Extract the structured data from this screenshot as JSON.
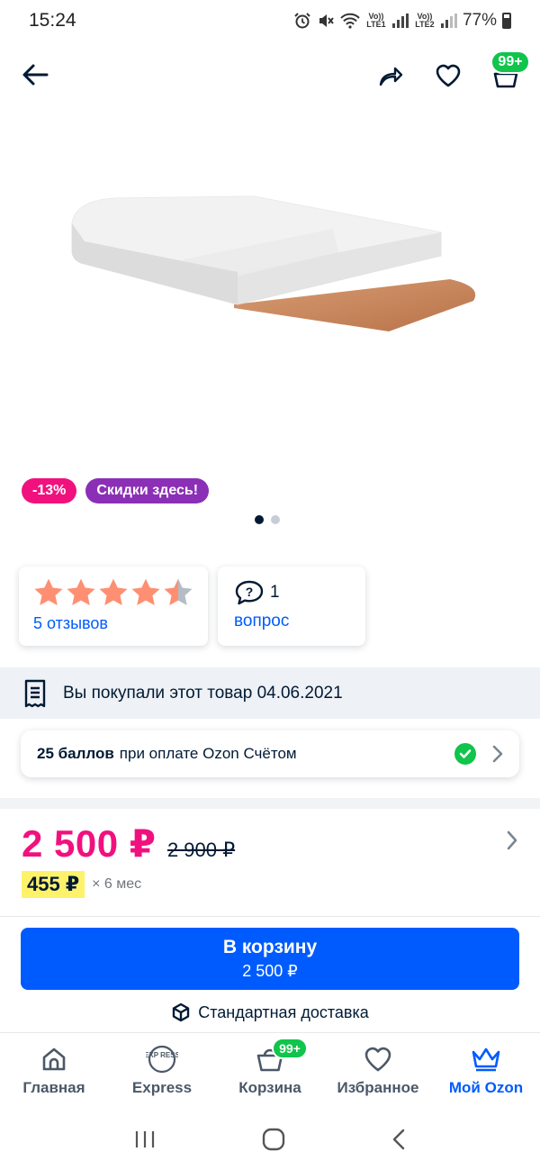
{
  "status_bar": {
    "time": "15:24",
    "sim1": "Vo)) LTE1",
    "sim2": "Vo)) LTE2",
    "battery": "77%"
  },
  "top_nav": {
    "cart_badge": "99+"
  },
  "product": {
    "badges": {
      "discount": "-13%",
      "sale": "Скидки здесь!"
    },
    "images_count": 2,
    "active_image": 1
  },
  "rating": {
    "stars": 4.5,
    "reviews_label": "5 отзывов"
  },
  "questions": {
    "count": "1",
    "label": "вопрос"
  },
  "purchased": {
    "text": "Вы покупали этот товар 04.06.2021"
  },
  "points": {
    "amount": "25 баллов",
    "text": "при оплате Ozon Счётом"
  },
  "price": {
    "current": "2 500 ₽",
    "old": "2 900 ₽",
    "installment_price": "455 ₽",
    "installment_term": "× 6 мес"
  },
  "cart_button": {
    "label": "В корзину",
    "price": "2 500 ₽"
  },
  "delivery": {
    "text": "Стандартная доставка"
  },
  "tabbar": {
    "home": "Главная",
    "express": "Express",
    "express_icon_text": "EXP RESS",
    "cart": "Корзина",
    "cart_badge": "99+",
    "favorites": "Избранное",
    "my_ozon": "Мой Ozon"
  },
  "colors": {
    "brand_blue": "#005bff",
    "price_pink": "#f1117e",
    "sale_purple": "#8b2fb6",
    "badge_green": "#10c44c",
    "installment_yellow": "#fff26b"
  }
}
